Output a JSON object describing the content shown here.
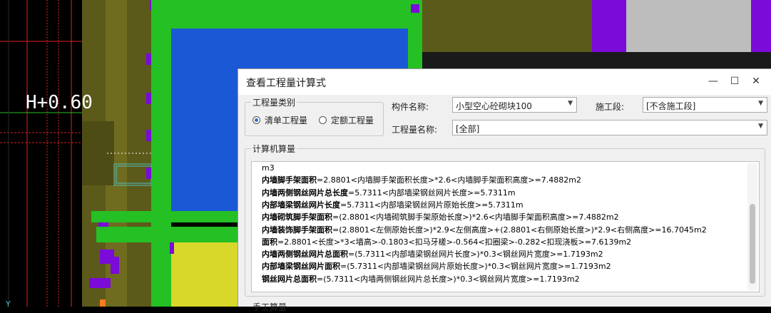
{
  "cad": {
    "elevation_label": "H+0.60"
  },
  "dialog": {
    "title": "查看工程量计算式",
    "qty_type_group": {
      "title": "工程量类别",
      "options": [
        "清单工程量",
        "定额工程量"
      ],
      "selected": "清单工程量"
    },
    "component_name": {
      "label": "构件名称:",
      "value": "小型空心砼砌块100"
    },
    "construction_stage": {
      "label": "施工段:",
      "value": "[不含施工段]"
    },
    "qty_name": {
      "label": "工程量名称:",
      "value": "[全部]"
    },
    "computed": {
      "title": "计算机算量",
      "lines": [
        {
          "name": "",
          "formula": "m3"
        },
        {
          "name": "内墙脚手架面积",
          "formula": "=2.8801<内墙脚手架面积长度>*2.6<内墙脚手架面积高度>=7.4882m2"
        },
        {
          "name": "内墙两侧钢丝网片总长度",
          "formula": "=5.7311<内部墙梁钢丝网片长度>=5.7311m"
        },
        {
          "name": "内部墙梁钢丝网片长度",
          "formula": "=5.7311<内部墙梁钢丝网片原始长度>=5.7311m"
        },
        {
          "name": "内墙砌筑脚手架面积",
          "formula": "=(2.8801<内墙砌筑脚手架原始长度>)*2.6<内墙脚手架面积高度>=7.4882m2"
        },
        {
          "name": "内墙装饰脚手架面积",
          "formula": "=(2.8801<左侧原始长度>)*2.9<左侧高度>+(2.8801<右侧原始长度>)*2.9<右侧高度>=16.7045m2"
        },
        {
          "name": "面积",
          "formula": "=2.8801<长度>*3<墙高>-0.1803<扣马牙槎>-0.564<扣圈梁>-0.282<扣现浇板>=7.6139m2"
        },
        {
          "name": "内墙两侧钢丝网片总面积",
          "formula": "=(5.7311<内部墙梁钢丝网片长度>)*0.3<钢丝网片宽度>=1.7193m2"
        },
        {
          "name": "内部墙梁钢丝网片面积",
          "formula": "=(5.7311<内部墙梁钢丝网片原始长度>)*0.3<钢丝网片宽度>=1.7193m2"
        },
        {
          "name": "钢丝网片总面积",
          "formula": "=(5.7311<内墙两侧钢丝网片总长度>)*0.3<钢丝网片宽度>=1.7193m2"
        }
      ]
    },
    "manual": {
      "title": "手工算量"
    }
  }
}
